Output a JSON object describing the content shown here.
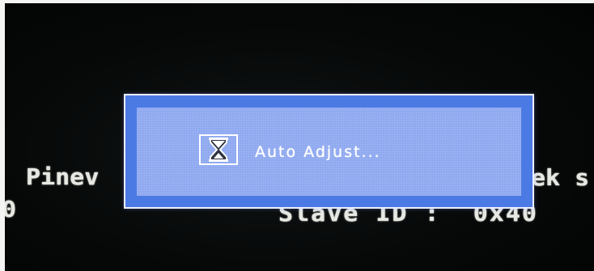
{
  "boot_screen": {
    "left_line_1": "Pinev",
    "left_line_2": "0",
    "right_line_1": "ek s",
    "right_line_2": "Slave ID :  0x40"
  },
  "osd": {
    "icon": "hourglass-icon",
    "message": "Auto Adjust...",
    "colors": {
      "outer": "#4c7ae4",
      "inner": "#8ea8f0",
      "border": "#eeeeff"
    }
  }
}
